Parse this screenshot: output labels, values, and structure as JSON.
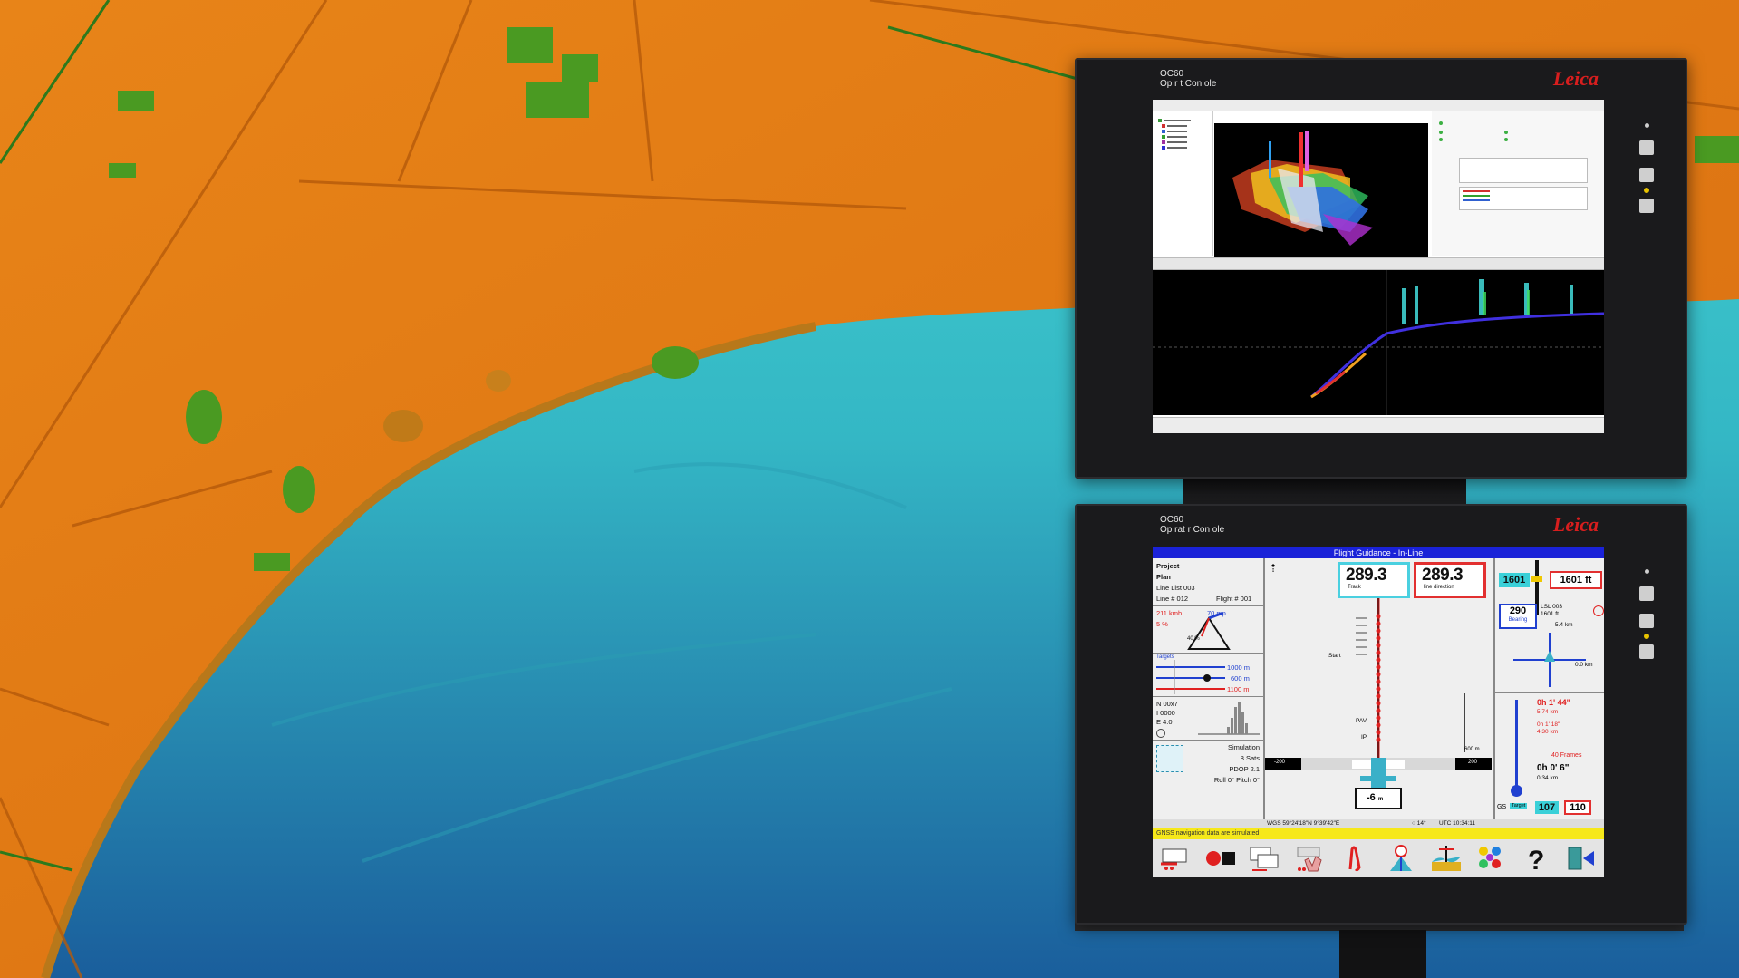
{
  "top_monitor": {
    "label_line1": "OC60",
    "label_line2": "Op r t   Con ole",
    "brand": "Leica"
  },
  "bottom_monitor": {
    "label_line1": "OC60",
    "label_line2": "Op rat r Con ole",
    "brand": "Leica",
    "app": {
      "title": "Flight Guidance - In-Line",
      "left_panel": {
        "project_label": "Project",
        "plan_label": "Plan",
        "line_list": "Line List  003",
        "line_no": "Line #   012",
        "flight_no": "Flight # 001",
        "speed_left": "211 kmh",
        "speed_right": "70 mp",
        "pct": "5 %",
        "tri_pct": "40 %",
        "target_label": "Targets",
        "dist1": "1000 m",
        "dist2": "600 m",
        "dist3": "1100 m",
        "n_val": "N 00x7",
        "l_val": "I 0000",
        "e_val": "E 4.0",
        "simulation": "Simulation",
        "sats": "8 Sats",
        "pdop": "PDOP 2.1",
        "roll_pitch": "Roll 0°  Pitch 0°"
      },
      "center_panel": {
        "track_value": "289.3",
        "track_label": "Track",
        "line_dir_value": "289.3",
        "line_dir_label": "line direction",
        "start_label": "Start",
        "pav_label": "PAV",
        "ip_label": "IP",
        "scale_left": "-200",
        "scale_right": "200",
        "bar_label": "600 m",
        "offset_value": "-6",
        "offset_unit": "m"
      },
      "right_panel": {
        "alt_actual": "1601",
        "alt_target": "1601 ft",
        "bearing_value": "290",
        "bearing_label": "Bearing",
        "lsl": "LSL 003",
        "lsl_alt": "1601 ft",
        "dist_top": "5.4 km",
        "dist_right": "0.0 km",
        "time1": "0h 1' 44\"",
        "dist_time1": "5.74 km",
        "time2": "0h 1' 18\"",
        "dist_time2": "4.30 km",
        "frames": "40 Frames",
        "time3": "0h 0' 6\"",
        "dist_time3": "0.34 km",
        "gs_label": "GS",
        "target_label": "Target",
        "gs_actual": "107",
        "gs_target": "110"
      },
      "ticker": {
        "coords": "WGS 59°24'18\"N 9°39'42\"E",
        "heading": "○ 14°",
        "utc": "UTC 10:34:11"
      },
      "warning": "GNSS navigation data are simulated",
      "toolbar_icons": [
        "line-select-icon",
        "record-stop-icon",
        "window-switch-icon",
        "touch-hand-icon",
        "annotate-icon",
        "camera-trigger-icon",
        "terrain-icon",
        "colors-icon",
        "help-icon",
        "exit-icon"
      ]
    }
  },
  "colors": {
    "land": "#e07a14",
    "water_near": "#3bc9c9",
    "water_far": "#1b6fa3",
    "brand_red": "#d81e1e",
    "title_blue": "#1a22d8",
    "warning_yellow": "#f6e81a",
    "cyan_box": "#3ad0d8"
  }
}
